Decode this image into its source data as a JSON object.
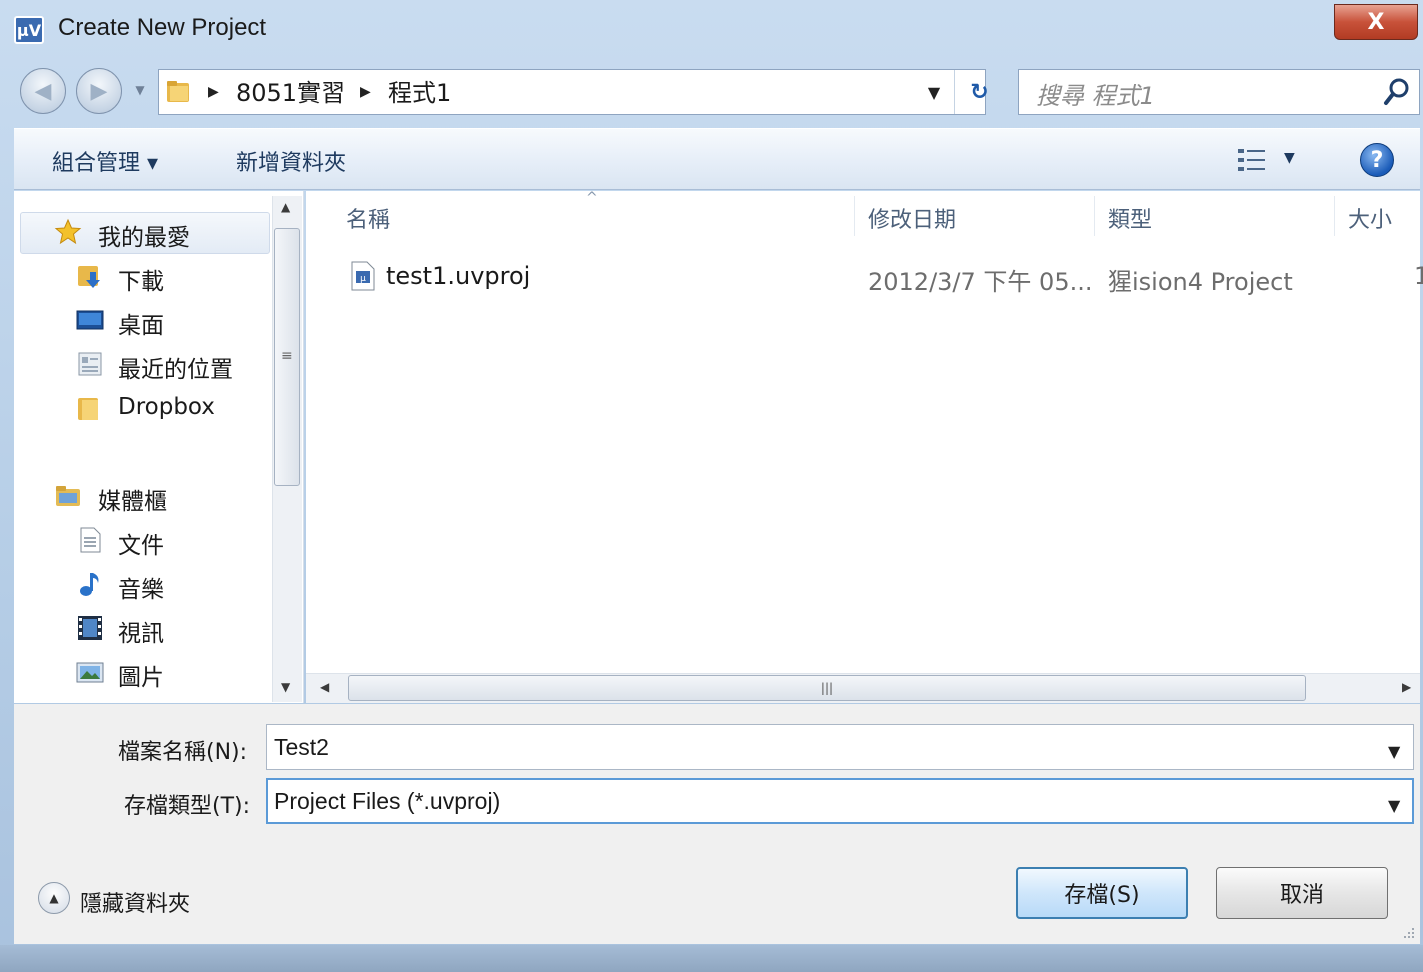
{
  "window": {
    "title": "Create New Project",
    "close_glyph": "X",
    "app_icon_glyph": "μV"
  },
  "address": {
    "crumbs": [
      "8051實習",
      "程式1"
    ],
    "search_placeholder": "搜尋 程式1"
  },
  "toolbar": {
    "organize_label": "組合管理 ▾",
    "new_folder_label": "新增資料夾",
    "help_glyph": "?"
  },
  "nav": {
    "favorites_label": "我的最愛",
    "favorites_items": [
      "下載",
      "桌面",
      "最近的位置",
      "Dropbox"
    ],
    "libraries_label": "媒體櫃",
    "library_items": [
      "文件",
      "音樂",
      "視訊",
      "圖片"
    ]
  },
  "files": {
    "columns": [
      "名稱",
      "修改日期",
      "類型",
      "大小"
    ],
    "rows": [
      {
        "name": "test1.uvproj",
        "date": "2012/3/7 下午 05...",
        "type": "猩ision4 Project",
        "size": "1"
      }
    ]
  },
  "form": {
    "filename_label": "檔案名稱(N):",
    "filename_value": "Test2",
    "filetype_label": "存檔類型(T):",
    "filetype_value": "Project Files (*.uvproj)"
  },
  "footer": {
    "hide_folders_label": "隱藏資料夾",
    "save_label": "存檔(S)",
    "cancel_label": "取消"
  }
}
